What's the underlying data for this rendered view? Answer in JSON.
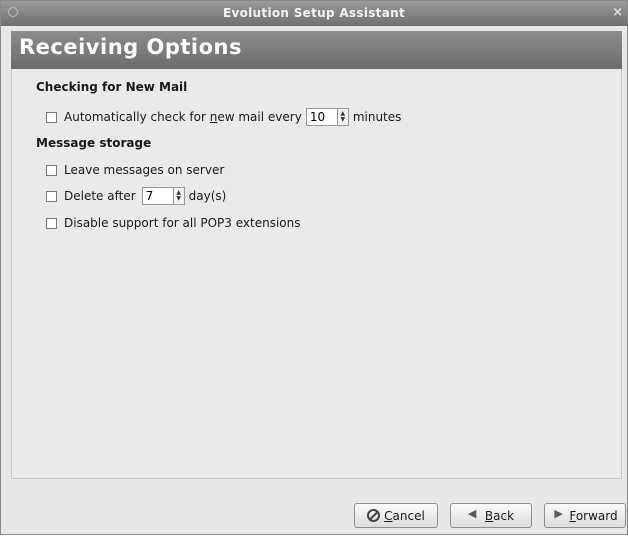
{
  "window": {
    "title": "Evolution Setup Assistant"
  },
  "page": {
    "heading": "Receiving Options"
  },
  "checking": {
    "section_title": "Checking for New Mail",
    "auto_check": {
      "label_before": "Automatically check for ",
      "label_mnemonic": "n",
      "label_after": "ew mail every",
      "value": "10",
      "unit": "minutes",
      "checked": false
    }
  },
  "storage": {
    "section_title": "Message storage",
    "leave_on_server": {
      "label": "Leave messages on server",
      "checked": false
    },
    "delete_after": {
      "label": "Delete after",
      "value": "7",
      "unit": "day(s)",
      "checked": false
    },
    "disable_pop3": {
      "label": "Disable support for all POP3 extensions",
      "checked": false
    }
  },
  "buttons": {
    "cancel": {
      "mnemonic": "C",
      "rest": "ancel"
    },
    "back": {
      "mnemonic": "B",
      "rest": "ack"
    },
    "forward": {
      "mnemonic": "F",
      "rest": "orward"
    }
  }
}
